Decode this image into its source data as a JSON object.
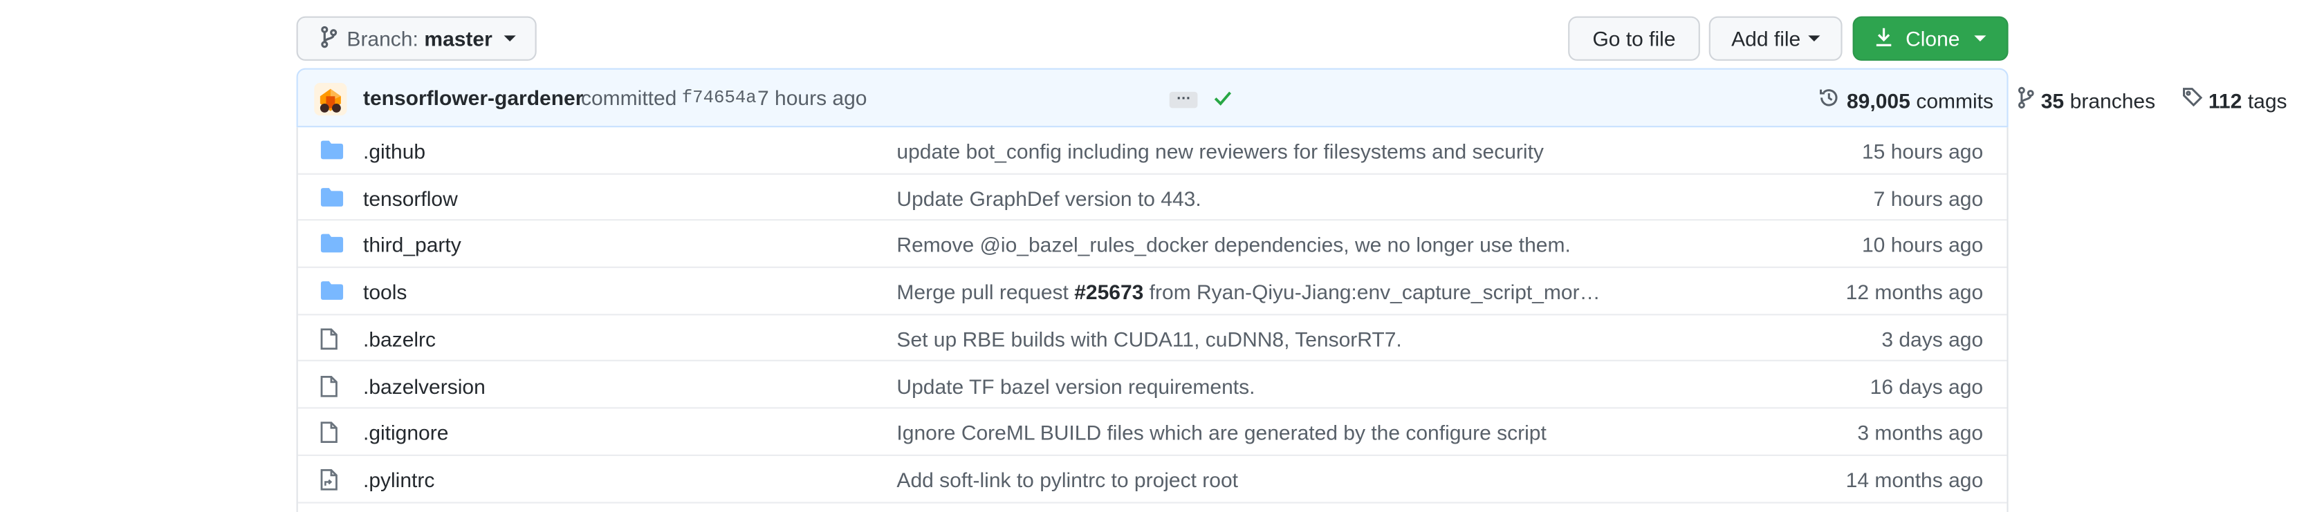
{
  "toolbar": {
    "branch_label": "Branch:",
    "branch_value": "master",
    "go_to_file": "Go to file",
    "add_file": "Add file",
    "clone": "Clone"
  },
  "commit": {
    "author": "tensorflower-gardener",
    "action": "committed",
    "sha": "f74654a",
    "time": "7 hours ago",
    "ellipsis": "…",
    "status": "success"
  },
  "stats": {
    "commits_count": "89,005",
    "commits_label": "commits",
    "branches_count": "35",
    "branches_label": "branches",
    "tags_count": "112",
    "tags_label": "tags"
  },
  "files": [
    {
      "type": "dir",
      "name": ".github",
      "message": "update bot_config including new reviewers for filesystems and security",
      "time": "15 hours ago"
    },
    {
      "type": "dir",
      "name": "tensorflow",
      "message": "Update GraphDef version to 443.",
      "time": "7 hours ago"
    },
    {
      "type": "dir",
      "name": "third_party",
      "message": "Remove @io_bazel_rules_docker dependencies, we no longer use them.",
      "time": "10 hours ago"
    },
    {
      "type": "dir",
      "name": "tools",
      "message_pre": "Merge pull request ",
      "message_link": "#25673",
      "message_post": " from Ryan-Qiyu-Jiang:env_capture_script_mor…",
      "time": "12 months ago"
    },
    {
      "type": "file",
      "name": ".bazelrc",
      "message": "Set up RBE builds with CUDA11, cuDNN8, TensorRT7.",
      "time": "3 days ago"
    },
    {
      "type": "file",
      "name": ".bazelversion",
      "message": "Update TF bazel version requirements.",
      "time": "16 days ago"
    },
    {
      "type": "file",
      "name": ".gitignore",
      "message": "Ignore CoreML BUILD files which are generated by the configure script",
      "time": "3 months ago"
    },
    {
      "type": "symlink",
      "name": ".pylintrc",
      "message": "Add soft-link to pylintrc to project root",
      "time": "14 months ago"
    }
  ],
  "colors": {
    "clone_green": "#2ea44f",
    "commit_bar_bg": "#f1f8ff",
    "folder_blue": "#79b8ff",
    "check_green": "#28a745"
  }
}
